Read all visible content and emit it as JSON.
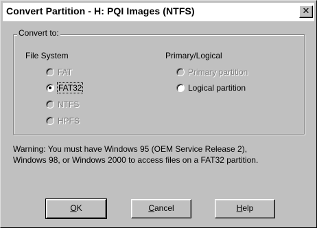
{
  "window": {
    "title": "Convert Partition - H: PQI Images (NTFS)",
    "close_glyph": "✕"
  },
  "group": {
    "legend": "Convert to:",
    "file_system": {
      "header": "File System",
      "options": [
        {
          "label": "FAT",
          "selected": false,
          "enabled": false
        },
        {
          "label": "FAT32",
          "selected": true,
          "enabled": true
        },
        {
          "label": "NTFS",
          "selected": false,
          "enabled": false
        },
        {
          "label": "HPFS",
          "selected": false,
          "enabled": false
        }
      ]
    },
    "primary_logical": {
      "header": "Primary/Logical",
      "options": [
        {
          "label": "Primary partition",
          "selected": false,
          "enabled": false
        },
        {
          "label": "Logical partition",
          "selected": false,
          "enabled": true
        }
      ]
    }
  },
  "warning": {
    "line1": "Warning: You must have Windows 95 (OEM Service Release 2),",
    "line2": "Windows 98, or Windows 2000 to access files on a FAT32 partition."
  },
  "buttons": {
    "ok": {
      "mnemonic": "O",
      "rest": "K"
    },
    "cancel": {
      "mnemonic": "C",
      "rest": "ancel"
    },
    "help": {
      "mnemonic": "H",
      "rest": "elp"
    }
  }
}
